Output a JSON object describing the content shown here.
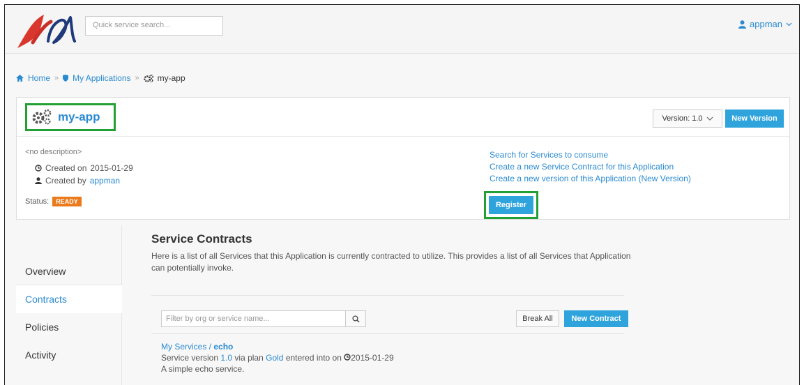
{
  "header": {
    "search_placeholder": "Quick service search...",
    "user_name": "appman",
    "colors": {
      "link": "#2a8ad0",
      "button": "#2fa4dc",
      "highlight": "#23a033",
      "status_ready": "#ea7a1c"
    }
  },
  "breadcrumb": {
    "home": "Home",
    "applications": "My Applications",
    "current": "my-app",
    "separator": "»"
  },
  "app": {
    "name": "my-app",
    "version_label": "Version: 1.0",
    "new_version_label": "New Version",
    "description": "<no description>",
    "created_on_prefix": "Created on",
    "created_on": "2015-01-29",
    "created_by_prefix": "Created by",
    "created_by": "appman",
    "status_label": "Status:",
    "status_value": "READY",
    "actions": [
      "Search for Services to consume",
      "Create a new Service Contract for this Application",
      "Create a new version of this Application (New Version)"
    ],
    "register_label": "Register"
  },
  "nav": {
    "items": [
      "Overview",
      "Contracts",
      "Policies",
      "Activity"
    ],
    "active": "Contracts"
  },
  "contracts": {
    "title": "Service Contracts",
    "intro": "Here is a list of all Services that this Application is currently contracted to utilize. This provides a list of all Services that Application can potentially invoke.",
    "filter_placeholder": "Filter by org or service name...",
    "break_all_label": "Break All",
    "new_contract_label": "New Contract",
    "items": [
      {
        "org": "My Services",
        "separator": " / ",
        "service": "echo",
        "version_prefix": "Service version",
        "version": "1.0",
        "plan_prefix": "via plan",
        "plan": "Gold",
        "entered_prefix": "entered into on",
        "date": "2015-01-29",
        "description": "A simple echo service."
      }
    ]
  }
}
